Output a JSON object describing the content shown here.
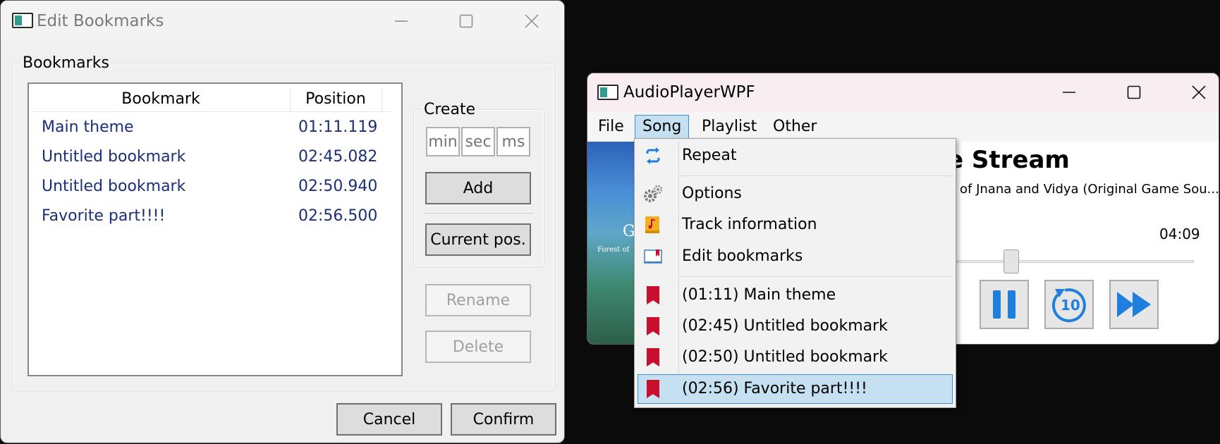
{
  "edit_window": {
    "title": "Edit Bookmarks",
    "group_title": "Bookmarks",
    "columns": [
      "Bookmark",
      "Position"
    ],
    "rows": [
      {
        "name": "Main theme",
        "position": "01:11.119"
      },
      {
        "name": "Untitled bookmark",
        "position": "02:45.082"
      },
      {
        "name": "Untitled bookmark",
        "position": "02:50.940"
      },
      {
        "name": "Favorite part!!!!",
        "position": "02:56.500"
      }
    ],
    "create": {
      "title": "Create",
      "min_placeholder": "min",
      "sec_placeholder": "sec",
      "ms_placeholder": "ms",
      "add_label": "Add",
      "current_pos_label": "Current pos."
    },
    "rename_label": "Rename",
    "delete_label": "Delete",
    "cancel_label": "Cancel",
    "confirm_label": "Confirm"
  },
  "player_window": {
    "title": "AudioPlayerWPF",
    "menu": [
      "File",
      "Song",
      "Playlist",
      "Other"
    ],
    "song_title_fragment": "e Stream",
    "album_fragment": "of Jnana and Vidya (Original Game Sou...",
    "duration": "04:09",
    "art_text": "G",
    "art_subtext": "Forest of",
    "replay_label": "10",
    "song_menu": {
      "repeat": "Repeat",
      "options": "Options",
      "track_info": "Track information",
      "edit_bookmarks": "Edit bookmarks",
      "bookmarks": [
        "(01:11) Main theme",
        "(02:45) Untitled bookmark",
        "(02:50) Untitled bookmark",
        "(02:56) Favorite part!!!!"
      ]
    }
  },
  "colors": {
    "accent": "#0078d7",
    "bookmark_red": "#c8102e",
    "list_text": "#1a2f7a",
    "menu_highlight": "#c5e0f0"
  },
  "icons": [
    "repeat-icon",
    "gear-icon",
    "music-note-icon",
    "bookmark-book-icon",
    "bookmark-icon",
    "pause-icon",
    "replay-10-icon",
    "fast-forward-icon",
    "minimize-icon",
    "maximize-icon",
    "close-icon"
  ]
}
